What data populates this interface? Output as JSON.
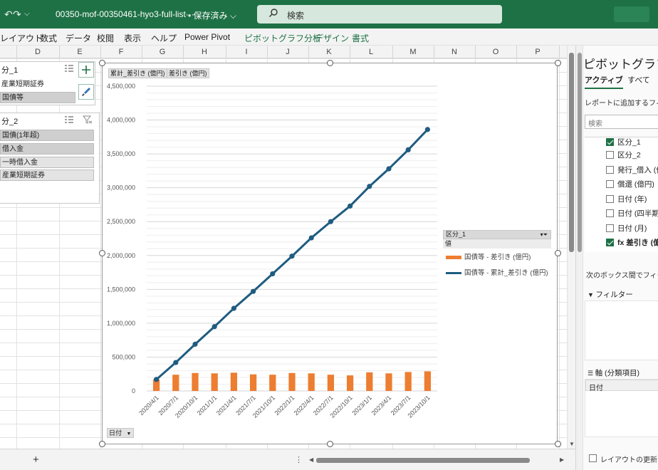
{
  "titlebar": {
    "file_name": "00350-mof-00350461-hyo3-full-list···",
    "save_status": "• 保存済み ⌵",
    "search_placeholder": "検索"
  },
  "ribbon": {
    "tabs": [
      "レイアウト",
      "数式",
      "データ",
      "校閲",
      "表示",
      "ヘルプ",
      "Power Pivot"
    ],
    "context_tabs": [
      "ピボットグラフ分析",
      "デザイン",
      "書式"
    ]
  },
  "columns": [
    "D",
    "E",
    "F",
    "G",
    "H",
    "I",
    "J",
    "K",
    "L",
    "M",
    "N",
    "O",
    "P"
  ],
  "slicer1": {
    "title": "分_1",
    "items": [
      {
        "label": "産業短期証券",
        "selected": false
      },
      {
        "label": "国債等",
        "selected": true
      }
    ]
  },
  "slicer2": {
    "title": "分_2",
    "items": [
      {
        "label": "国債(1年超)",
        "selected": true
      },
      {
        "label": "借入金",
        "selected": true
      },
      {
        "label": "一時借入金",
        "selected": false
      },
      {
        "label": "産業短期証券",
        "selected": false
      }
    ]
  },
  "chart": {
    "field_buttons": [
      "累計_差引き (億円)",
      "差引き (億円)"
    ],
    "axis_button": "日付",
    "legend_header": "区分_1",
    "legend_values_label": "値",
    "legend_entries": [
      "国債等 - 差引き (億円)",
      "国債等 - 累計_差引き (億円)"
    ],
    "bar_color": "#ed7d31",
    "line_color": "#1f5c80"
  },
  "chart_data": {
    "type": "bar",
    "categories": [
      "2020/4/1",
      "2020/7/1",
      "2020/10/1",
      "2021/1/1",
      "2021/4/1",
      "2021/7/1",
      "2021/10/1",
      "2022/1/1",
      "2022/4/1",
      "2022/7/1",
      "2022/10/1",
      "2023/1/1",
      "2023/4/1",
      "2023/7/1",
      "2023/10/1"
    ],
    "series": [
      {
        "name": "国債等 - 差引き (億円)",
        "type": "bar",
        "values": [
          170000,
          240000,
          265000,
          260000,
          270000,
          245000,
          240000,
          265000,
          260000,
          240000,
          230000,
          275000,
          260000,
          280000,
          290000
        ]
      },
      {
        "name": "国債等 - 累計_差引き (億円)",
        "type": "line",
        "values": [
          170000,
          420000,
          690000,
          950000,
          1220000,
          1470000,
          1730000,
          1990000,
          2260000,
          2500000,
          2730000,
          3020000,
          3280000,
          3560000,
          3860000
        ]
      }
    ],
    "yticks": [
      "4,500,000",
      "4,000,000",
      "3,500,000",
      "3,000,000",
      "2,500,000",
      "2,000,000",
      "1,500,000",
      "1,000,000",
      "500,000",
      "0"
    ],
    "ylim": [
      0,
      4500000
    ],
    "legend": "right",
    "grid": true
  },
  "pane": {
    "title": "ピボットグラフの",
    "tab_active": "アクティブ",
    "tab_all": "すべて",
    "add_fields_label": "レポートに追加するフィール",
    "search_placeholder": "検索",
    "fields": [
      {
        "label": "区分_1",
        "checked": true
      },
      {
        "label": "区分_2",
        "checked": false
      },
      {
        "label": "発行_借入 (億",
        "checked": false
      },
      {
        "label": "償還 (億円)",
        "checked": false
      },
      {
        "label": "日付 (年)",
        "checked": false
      },
      {
        "label": "日付 (四半期",
        "checked": false
      },
      {
        "label": "日付 (月)",
        "checked": false
      },
      {
        "label": "fx 差引き (億",
        "checked": true
      }
    ],
    "drag_hint": "次のボックス間でフィールド",
    "filter_label": "フィルター",
    "axis_label": "軸 (分類項目)",
    "axis_value": "日付",
    "defer_label": "レイアウトの更新を保"
  }
}
